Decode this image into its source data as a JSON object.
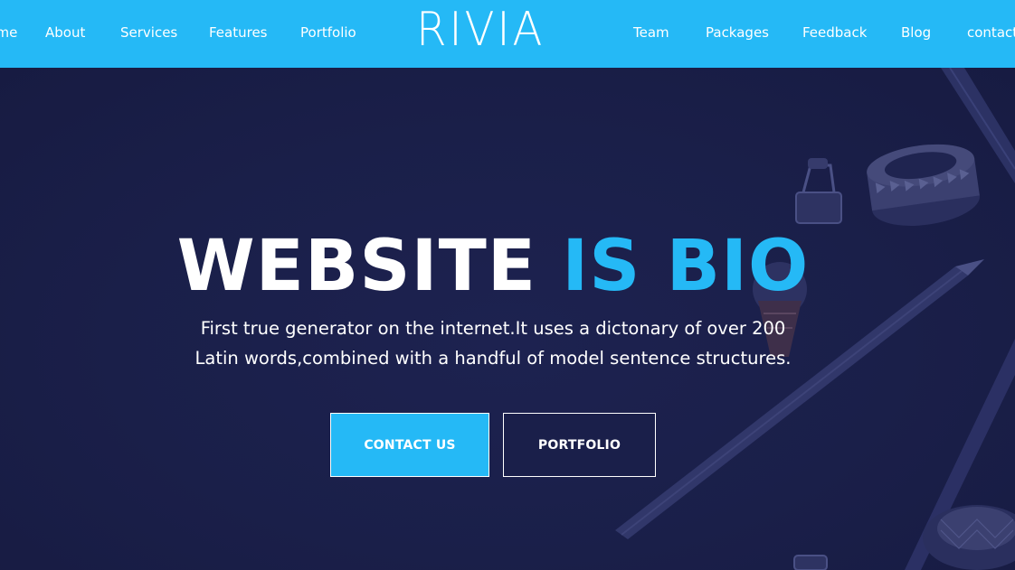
{
  "brand": {
    "logo": "RIVIA"
  },
  "nav": {
    "left": [
      "Home",
      "About",
      "Services",
      "Features",
      "Portfolio"
    ],
    "right": [
      "Team",
      "Packages",
      "Feedback",
      "Blog",
      "contact"
    ]
  },
  "hero": {
    "headline_white": "WEBSITE",
    "headline_accent": "IS BIO",
    "subtext_line1": "First true generator on the internet.It uses a dictonary of over 200",
    "subtext_line2": "Latin words,combined with a handful of model sentence structures.",
    "contact_button": "CONTACT US",
    "portfolio_button": "PORTFOLIO"
  },
  "colors": {
    "accent": "#25b9f6",
    "hero_background": "#1a1f4a",
    "text": "#ffffff"
  },
  "icons": {
    "decor": [
      "pencil-icon",
      "paper-clip-icon",
      "washi-tape-icon",
      "ice-cream-eraser-icon"
    ]
  }
}
